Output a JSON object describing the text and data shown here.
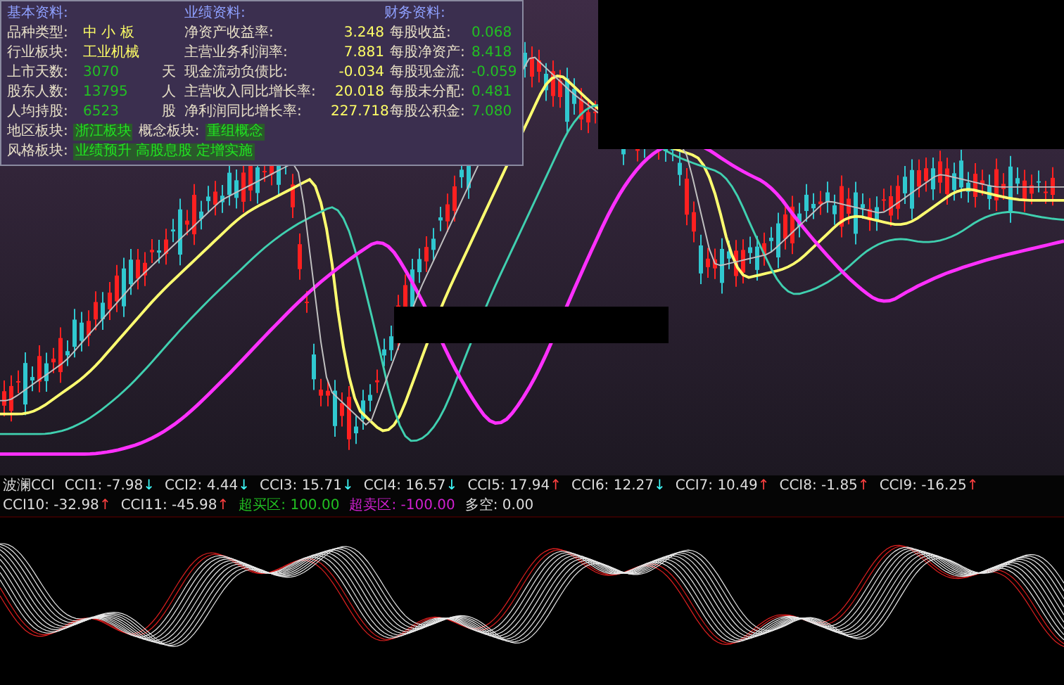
{
  "info_panel": {
    "headers": [
      "基本资料:",
      "业绩资料:",
      "财务资料:"
    ],
    "rows": [
      {
        "cells": [
          {
            "label": "品种类型:",
            "value": "中 小 板"
          },
          {
            "label": "净资产收益率:",
            "value": "3.248"
          },
          {
            "label": "每股收益:",
            "value": "0.068"
          }
        ]
      },
      {
        "cells": [
          {
            "label": "行业板块:",
            "value": "工业机械"
          },
          {
            "label": "主营业务利润率:",
            "value": "7.881"
          },
          {
            "label": "每股净资产:",
            "value": "8.418"
          }
        ]
      },
      {
        "cells": [
          {
            "label": "上市天数:",
            "value": "3070",
            "unit": "天"
          },
          {
            "label": "现金流动负债比:",
            "value": "-0.034"
          },
          {
            "label": "每股现金流:",
            "value": "-0.059"
          }
        ]
      },
      {
        "cells": [
          {
            "label": "股东人数:",
            "value": "13795",
            "unit": "人"
          },
          {
            "label": "主营收入同比增长率:",
            "value": "20.018"
          },
          {
            "label": "每股未分配:",
            "value": "0.481"
          }
        ]
      },
      {
        "cells": [
          {
            "label": "人均持股:",
            "value": "6523",
            "unit": "股"
          },
          {
            "label": "净利润同比增长率:",
            "value": "227.718"
          },
          {
            "label": "每股公积金:",
            "value": "7.080"
          }
        ]
      }
    ],
    "region": {
      "label": "地区板块:",
      "value": "浙江板块"
    },
    "concept": {
      "label": "概念板块:",
      "value": "重组概念"
    },
    "style": {
      "label": "风格板块:",
      "value": "业绩预升 高股息股 定增实施"
    }
  },
  "indicator_bar": {
    "name": "波澜CCI",
    "items": [
      {
        "kind": "value",
        "label": "CCI1: -7.98",
        "arrow": "↓"
      },
      {
        "kind": "value",
        "label": "CCI2: 4.44",
        "arrow": "↓"
      },
      {
        "kind": "value",
        "label": "CCI3: 15.71",
        "arrow": "↓"
      },
      {
        "kind": "value",
        "label": "CCI4: 16.57",
        "arrow": "↓"
      },
      {
        "kind": "value",
        "label": "CCI5: 17.94",
        "arrow": "↑"
      },
      {
        "kind": "value",
        "label": "CCI6: 12.27",
        "arrow": "↓"
      },
      {
        "kind": "value",
        "label": "CCI7: 10.49",
        "arrow": "↑"
      },
      {
        "kind": "value",
        "label": "CCI8: -1.85",
        "arrow": "↑"
      },
      {
        "kind": "value",
        "label": "CCI9: -16.25",
        "arrow": "↑"
      },
      {
        "kind": "value",
        "label": "CCI10: -32.98",
        "arrow": "↑"
      },
      {
        "kind": "value",
        "label": "CCI11: -45.98",
        "arrow": "↑"
      },
      {
        "kind": "level",
        "label": "超买区",
        "value": ": 100.00",
        "color": "#22c022"
      },
      {
        "kind": "level",
        "label": "超卖区",
        "value": ": -100.00",
        "color": "#d020d0"
      },
      {
        "kind": "plain",
        "label": "多空: 0.00"
      }
    ]
  }
}
